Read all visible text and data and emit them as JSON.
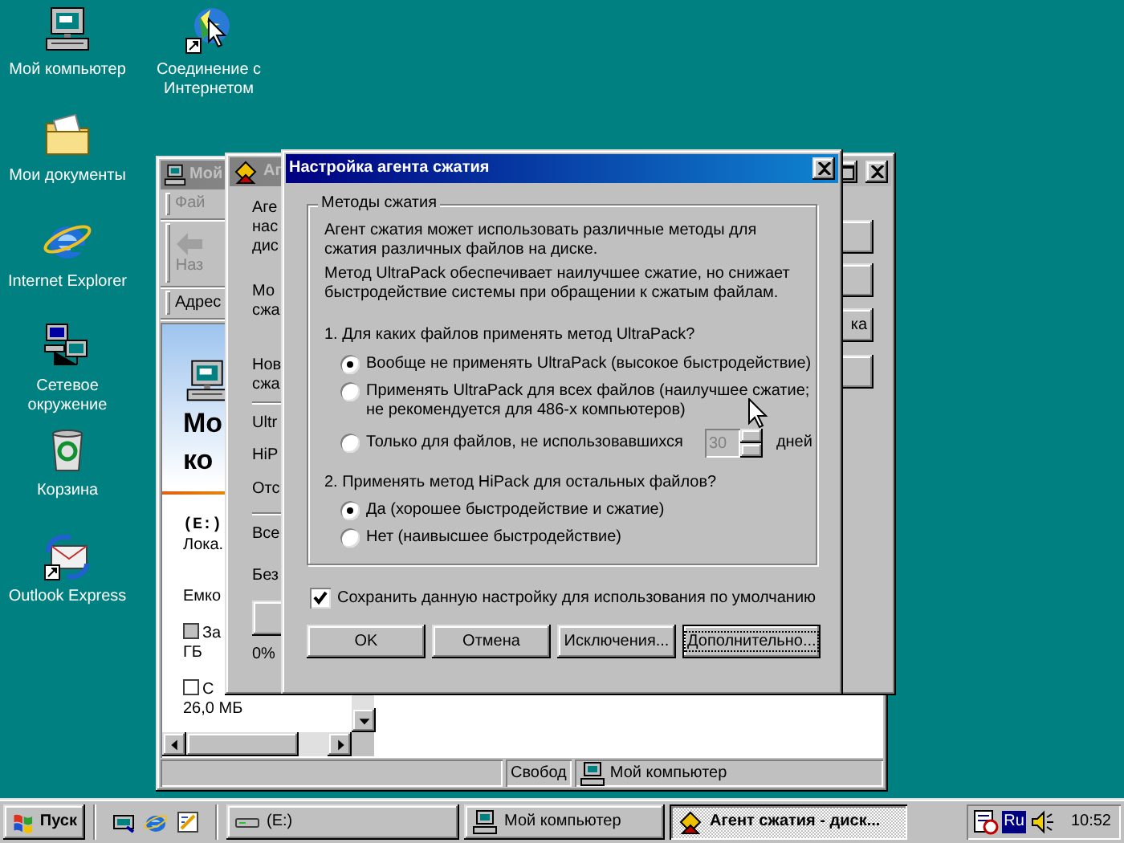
{
  "desktop_icons": [
    {
      "label": "Мой компьютер"
    },
    {
      "label": "Соединение с Интернетом"
    },
    {
      "label": "Мои документы"
    },
    {
      "label": "Internet Explorer"
    },
    {
      "label": "Сетевое окружение"
    },
    {
      "label": "Корзина"
    },
    {
      "label": "Outlook Express"
    }
  ],
  "explorer_window": {
    "title": "Мой",
    "menu": "Фай",
    "back_button": "Наз",
    "address_label": "Адрес",
    "heading_lines": [
      "Мо",
      "ко"
    ],
    "drive": "(E:)",
    "drive_type": "Лока.",
    "capacity": "Емко",
    "legend": [
      {
        "label": "За",
        "value": "ГБ",
        "filled": true
      },
      {
        "label": "С",
        "value": "26,0 МБ",
        "filled": false
      }
    ],
    "status_panels": [
      "Свобод",
      "Мой компьютер"
    ]
  },
  "agent_window": {
    "title": "Аг",
    "paragraphs": [
      [
        "Аге",
        "нас",
        "дис"
      ],
      [
        "Мо",
        "сжа"
      ],
      [
        "Нов",
        "сжа"
      ]
    ],
    "items": [
      "Ultr",
      "HiP",
      "Отс"
    ],
    "items_2": [
      "Все",
      "Без"
    ],
    "progress_text": "0%",
    "side_button_text": "ка"
  },
  "dialog": {
    "title": "Настройка агента сжатия",
    "group_title": "Методы сжатия",
    "intro": [
      "Агент сжатия может использовать различные методы для",
      "сжатия различных файлов на диске."
    ],
    "note": [
      "Метод UltraPack обеспечивает наилучшее сжатие, но снижает",
      "быстродействие системы при обращении к сжатым файлам."
    ],
    "question_1": "1. Для каких файлов применять метод UltraPack?",
    "options_1": [
      {
        "lines": [
          "Вообще не применять UltraPack (высокое быстродействие)"
        ],
        "selected": true
      },
      {
        "lines": [
          "Применять UltraPack для всех файлов (наилучшее сжатие;",
          "не рекомендуется для 486-х компьютеров)"
        ],
        "selected": false
      },
      {
        "lines": [
          "Только для файлов, не использовавшихся"
        ],
        "selected": false,
        "days_value": "30",
        "days_disabled": true,
        "days_unit": "дней"
      }
    ],
    "question_2": "2. Применять метод HiPack для остальных файлов?",
    "options_2": [
      {
        "lines": [
          "Да (хорошее быстродействие и сжатие)"
        ],
        "selected": true
      },
      {
        "lines": [
          "Нет (наивысшее быстродействие)"
        ],
        "selected": false
      }
    ],
    "save_default": {
      "label": "Сохранить данную настройку для использования по умолчанию",
      "checked": true
    },
    "buttons": [
      {
        "label": "OK",
        "default": false
      },
      {
        "label": "Отмена",
        "default": false
      },
      {
        "label": "Исключения...",
        "default": false
      },
      {
        "label": "Дополнительно...",
        "default": true
      }
    ]
  },
  "taskbar": {
    "start": "Пуск",
    "tasks": [
      {
        "label": "(E:)",
        "selected": false
      },
      {
        "label": "Мой компьютер",
        "selected": false
      },
      {
        "label": "Агент сжатия - диск...",
        "selected": true
      }
    ],
    "language": "Ru",
    "clock": "10:52"
  }
}
